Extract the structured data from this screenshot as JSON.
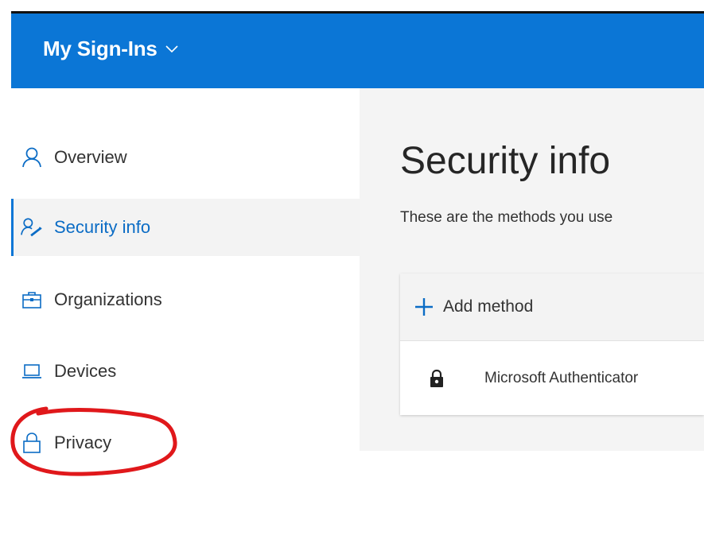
{
  "header": {
    "app_title": "My Sign-Ins",
    "dropdown_icon": "chevron-down-icon"
  },
  "sidebar": {
    "items": [
      {
        "label": "Overview",
        "icon": "person-icon",
        "active": false
      },
      {
        "label": "Security info",
        "icon": "person-key-icon",
        "active": true
      },
      {
        "label": "Organizations",
        "icon": "briefcase-icon",
        "active": false
      },
      {
        "label": "Devices",
        "icon": "laptop-icon",
        "active": false
      },
      {
        "label": "Privacy",
        "icon": "lock-icon",
        "active": false
      }
    ]
  },
  "main": {
    "title": "Security info",
    "subtitle": "These are the methods you use",
    "add_method_label": "Add method",
    "methods": [
      {
        "name": "Microsoft Authenticator",
        "icon": "authenticator-lock-icon"
      }
    ]
  },
  "colors": {
    "brand_blue": "#0b76d6",
    "annotation_red": "#e0181b"
  }
}
